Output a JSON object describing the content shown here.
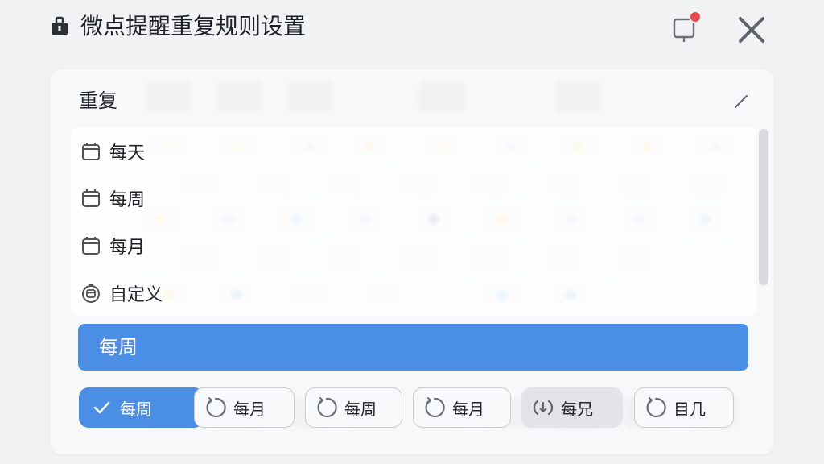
{
  "window": {
    "title": "微点提醒重复规则设置",
    "icons": {
      "app": "briefcase-icon",
      "notification": "notification-badge-icon",
      "close": "close-icon"
    },
    "notification_dot_color": "#e94b4b"
  },
  "panel": {
    "header": "重复",
    "options": [
      {
        "label": "每天",
        "icon": "calendar-icon"
      },
      {
        "label": "每周",
        "icon": "calendar-icon"
      },
      {
        "label": "每月",
        "icon": "calendar-icon"
      },
      {
        "label": "自定义",
        "icon": "custom-schedule-icon"
      }
    ],
    "selected": {
      "label": "每周",
      "color": "#4a8ee6"
    },
    "chips": [
      {
        "label": "每周",
        "icon": "check-icon",
        "state": "active"
      },
      {
        "label": "每月",
        "icon": "repeat-circle-icon",
        "state": "default"
      },
      {
        "label": "每周",
        "icon": "repeat-circle-icon",
        "state": "default"
      },
      {
        "label": "每月",
        "icon": "repeat-circle-icon",
        "state": "default"
      },
      {
        "label": "每兄",
        "icon": "download-circle-icon",
        "state": "muted"
      },
      {
        "label": "目几",
        "icon": "repeat-circle-icon",
        "state": "default"
      }
    ]
  }
}
